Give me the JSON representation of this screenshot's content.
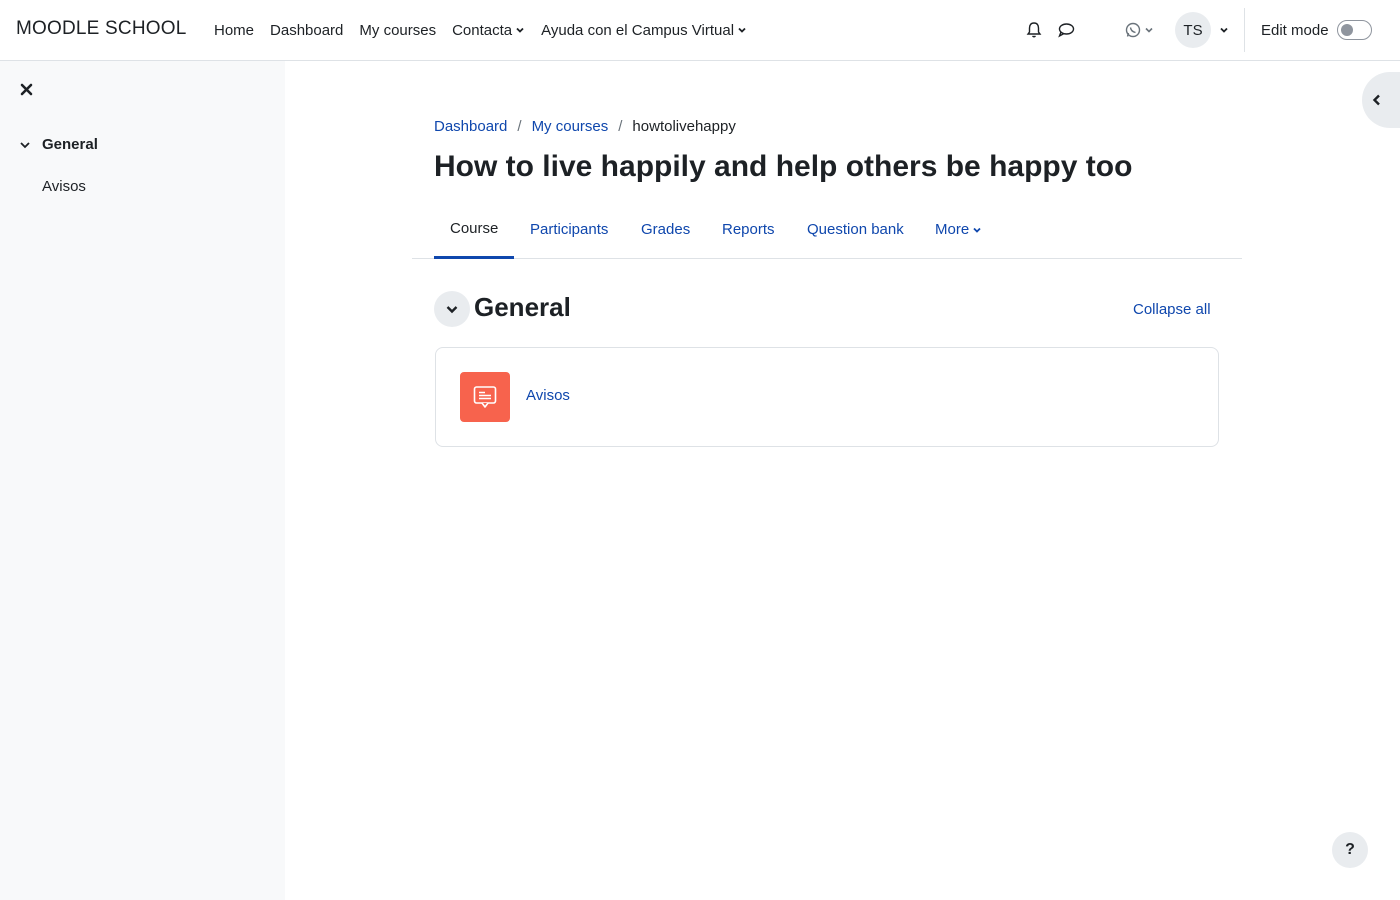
{
  "header": {
    "brand": "MOODLE SCHOOL",
    "nav": [
      {
        "label": "Home"
      },
      {
        "label": "Dashboard"
      },
      {
        "label": "My courses"
      },
      {
        "label": "Contacta",
        "dropdown": true
      },
      {
        "label": "Ayuda con el Campus Virtual",
        "dropdown": true
      }
    ],
    "icons": [
      "bell-icon",
      "chat-icon",
      "whatsapp-icon"
    ],
    "user_initials": "TS",
    "edit_mode_label": "Edit mode",
    "edit_mode_on": false
  },
  "drawer": {
    "section_label": "General",
    "items": [
      {
        "label": "Avisos"
      }
    ]
  },
  "breadcrumb": {
    "items": [
      {
        "label": "Dashboard"
      },
      {
        "label": "My courses"
      }
    ],
    "current": "howtolivehappy"
  },
  "page": {
    "title": "How to live happily and help others be happy too"
  },
  "secondary_nav": {
    "tabs": [
      {
        "label": "Course",
        "active": true
      },
      {
        "label": "Participants"
      },
      {
        "label": "Grades"
      },
      {
        "label": "Reports"
      },
      {
        "label": "Question bank"
      },
      {
        "label": "More",
        "dropdown": true
      }
    ]
  },
  "section": {
    "title": "General",
    "collapse_all": "Collapse all",
    "activities": [
      {
        "name": "Avisos",
        "icon": "forum-icon",
        "icon_color": "#f7634d"
      }
    ]
  },
  "help": {
    "label": "?"
  },
  "colors": {
    "link": "#0f47ad",
    "text": "#1d2125",
    "drawer_bg": "#f8f9fa",
    "forum_icon_bg": "#f7634d"
  }
}
